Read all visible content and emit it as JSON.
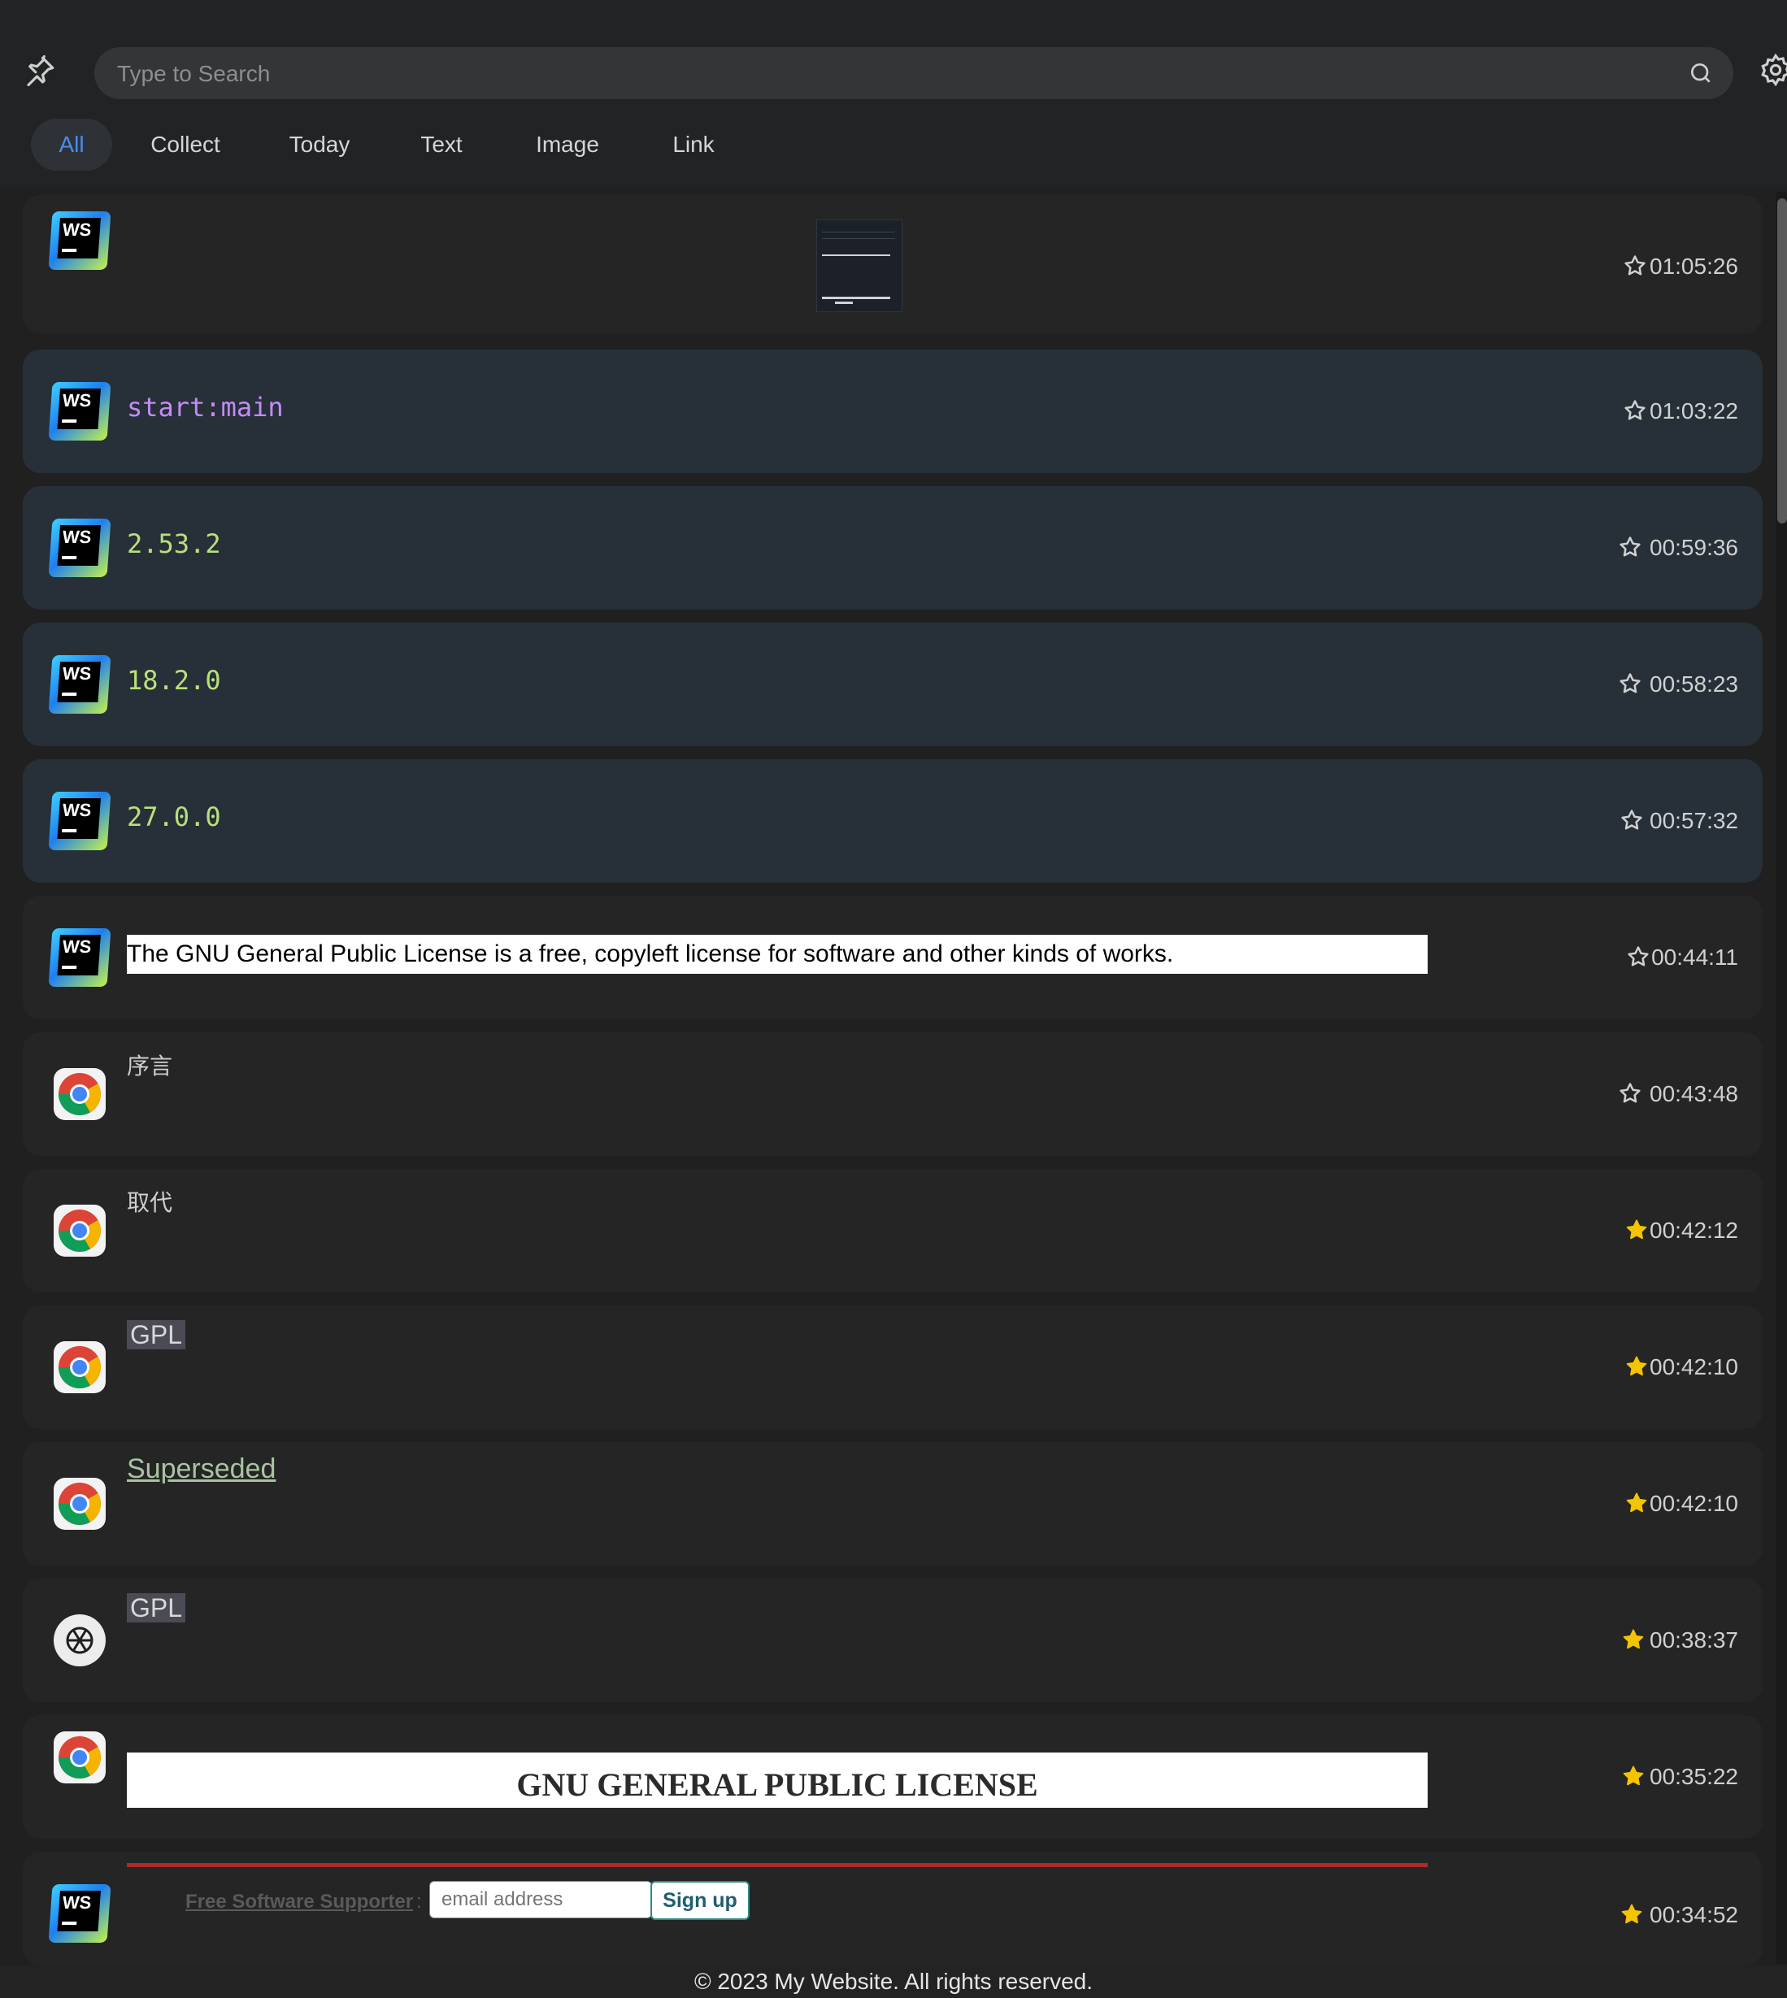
{
  "search": {
    "placeholder": "Type to Search"
  },
  "tabs": [
    "All",
    "Collect",
    "Today",
    "Text",
    "Image",
    "Link"
  ],
  "active_tab": "All",
  "colors": {
    "accent": "#4a8df0",
    "star_filled": "#f5c400",
    "code_purple": "#c58af9",
    "code_green": "#b9e07b"
  },
  "items": [
    {
      "app": "webstorm",
      "type": "image",
      "time": "01:05:26",
      "starred": false
    },
    {
      "app": "webstorm",
      "type": "code",
      "text": "start:main",
      "time": "01:03:22",
      "starred": false
    },
    {
      "app": "webstorm",
      "type": "code",
      "text": "2.53.2",
      "time": "00:59:36",
      "starred": false
    },
    {
      "app": "webstorm",
      "type": "code",
      "text": "18.2.0",
      "time": "00:58:23",
      "starred": false
    },
    {
      "app": "webstorm",
      "type": "code",
      "text": "27.0.0",
      "time": "00:57:32",
      "starred": false
    },
    {
      "app": "webstorm",
      "type": "rich",
      "text": "The GNU General Public License is a free, copyleft license for software and other kinds of works.",
      "time": "00:44:11",
      "starred": false
    },
    {
      "app": "chrome",
      "type": "text",
      "text": "序言",
      "time": "00:43:48",
      "starred": false
    },
    {
      "app": "chrome",
      "type": "text",
      "text": "取代",
      "time": "00:42:12",
      "starred": true
    },
    {
      "app": "chrome",
      "type": "text",
      "text": "GPL",
      "time": "00:42:10",
      "starred": true
    },
    {
      "app": "chrome",
      "type": "link",
      "text": "Superseded",
      "time": "00:42:10",
      "starred": true
    },
    {
      "app": "chatgpt",
      "type": "text",
      "text": "GPL",
      "time": "00:38:37",
      "starred": true
    },
    {
      "app": "chrome",
      "type": "rich",
      "text": "GNU GENERAL PUBLIC LICENSE",
      "time": "00:35:22",
      "starred": true
    },
    {
      "app": "webstorm",
      "type": "rich",
      "link_text": "Free Software Supporter",
      "input_placeholder": "email address",
      "button_label": "Sign up",
      "time": "00:34:52",
      "starred": true
    }
  ],
  "footer": "© 2023 My Website. All rights reserved."
}
